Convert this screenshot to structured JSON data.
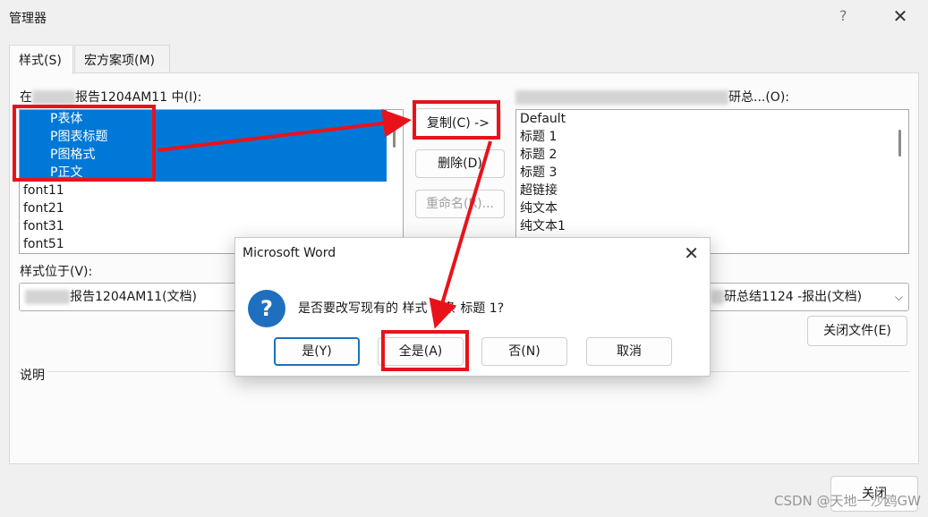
{
  "window": {
    "title": "管理器",
    "help_icon": "?",
    "close_icon": "✕"
  },
  "tabs": [
    {
      "label": "样式(S)"
    },
    {
      "label": "宏方案项(M)"
    }
  ],
  "left": {
    "header_prefix": "在",
    "header_suffix": "报告1204AM11 中(I):",
    "items": [
      {
        "label": "P表体",
        "selected": true
      },
      {
        "label": "P图表标题",
        "selected": true
      },
      {
        "label": "P图格式",
        "selected": true
      },
      {
        "label": "P正文",
        "selected": true
      },
      {
        "label": "font11",
        "selected": false
      },
      {
        "label": "font21",
        "selected": false
      },
      {
        "label": "font31",
        "selected": false
      },
      {
        "label": "font51",
        "selected": false
      }
    ],
    "location_label": "样式位于(V):",
    "location_value": "报告1204AM11(文档)"
  },
  "middle": {
    "copy_label": "复制(C) ->",
    "delete_label": "删除(D)",
    "rename_label": "重命名(R)..."
  },
  "right": {
    "header_suffix": "研总...(O):",
    "items": [
      {
        "label": "Default"
      },
      {
        "label": "标题 1"
      },
      {
        "label": "标题 2"
      },
      {
        "label": "标题 3"
      },
      {
        "label": "超链接"
      },
      {
        "label": "纯文本"
      },
      {
        "label": "纯文本1"
      }
    ],
    "location_value": "研总结1124 -报出(文档)",
    "close_file_label": "关闭文件(E)"
  },
  "description_label": "说明",
  "close_label": "关闭",
  "dialog": {
    "title": "Microsoft Word",
    "message": "是否要改写现有的 样式 词条 标题 1?",
    "yes_label": "是(Y)",
    "yes_all_label": "全是(A)",
    "no_label": "否(N)",
    "cancel_label": "取消",
    "close_icon": "✕"
  },
  "watermark": "CSDN @天地一沙鸥GW",
  "annotation_color": "#e8131a",
  "selection_color": "#0078d7"
}
